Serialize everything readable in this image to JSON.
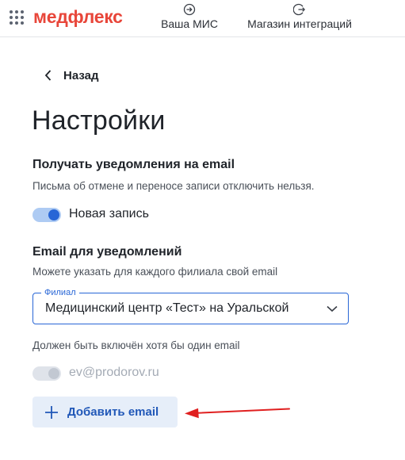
{
  "header": {
    "logo": "медфлекс",
    "nav": [
      {
        "label": "Ваша МИС",
        "icon": "login-icon"
      },
      {
        "label": "Магазин интеграций",
        "icon": "logout-icon"
      }
    ]
  },
  "back": {
    "label": "Назад"
  },
  "title": "Настройки",
  "notifications": {
    "heading": "Получать уведомления на email",
    "description": "Письма об отмене и переносе записи отключить нельзя.",
    "toggle_label": "Новая запись",
    "toggle_on": true
  },
  "email_section": {
    "heading": "Email для уведомлений",
    "description": "Можете указать для каждого филиала свой email",
    "select": {
      "legend": "Филиал",
      "value": "Медицинский центр «Тест» на Уральской"
    },
    "hint": "Должен быть включён хотя бы один email",
    "email_item": {
      "label": "ev@prodorov.ru",
      "toggle_on": true,
      "disabled": true
    },
    "add_button": "Добавить email"
  },
  "colors": {
    "brand": "#e8463a",
    "accent": "#2866d6",
    "annotation_arrow": "#e02020"
  }
}
